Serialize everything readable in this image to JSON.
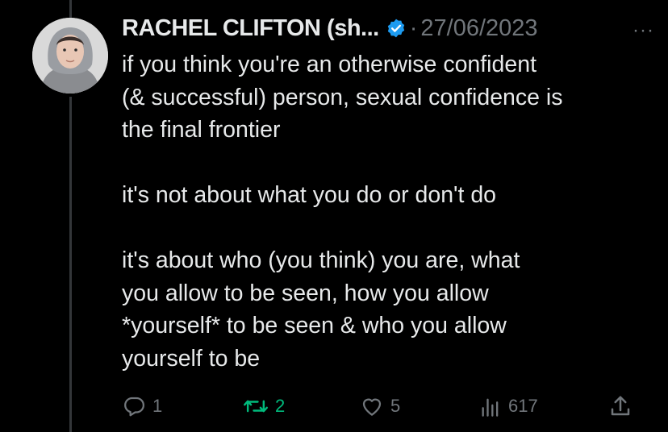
{
  "tweet": {
    "author": "RACHEL CLIFTON (sh...",
    "separator": "·",
    "date": "27/06/2023",
    "more": "···",
    "text": "if you think you're an otherwise confident\n(& successful) person, sexual confidence is\nthe final frontier\n\nit's not about what you do or don't do\n\nit's about who (you think) you are, what\nyou allow to be seen, how you allow\n*yourself* to be seen & who you allow\nyourself to be"
  },
  "actions": {
    "replies": "1",
    "retweets": "2",
    "likes": "5",
    "views": "617"
  },
  "icons": {
    "reply": "reply-icon",
    "retweet": "retweet-icon",
    "like": "heart-icon",
    "views": "views-icon",
    "share": "share-icon",
    "verified": "verified-badge-icon"
  },
  "colors": {
    "background": "#000000",
    "text": "#e7e9ea",
    "muted": "#71767b",
    "retweet_active": "#00ba7c",
    "verified": "#1d9bf0"
  }
}
